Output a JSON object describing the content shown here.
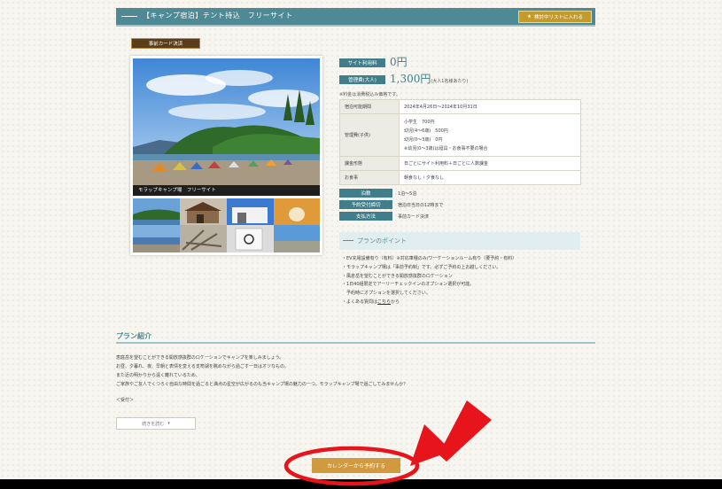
{
  "header": {
    "title": "【キャンプ宿泊】テント持込　フリーサイト",
    "wishlist_label": "検討中リストに入れる"
  },
  "badge": {
    "prepay": "事前カード決済"
  },
  "photo": {
    "caption": "モラップキャンプ場　フリーサイト"
  },
  "pricing": {
    "site_fee_label": "サイト利用料",
    "site_fee_value": "0円",
    "mgmt_fee_label": "管理費(大人)",
    "mgmt_fee_value": "1,300円",
    "mgmt_fee_unit": "(大人1名様あたり)",
    "tax_note": "※料金は消費税込み価格です。"
  },
  "info_table": {
    "period_label": "宿泊可能期間",
    "period_value": "2024年4月26日〜2024年10月31日",
    "child_label": "管理費(子供)",
    "child_values": [
      "小学生　700円",
      "幼児(4〜6歳)　500円",
      "幼児(0〜3歳)　0円",
      "※幼児(0〜3歳)は寝具・お食事不要の場合"
    ],
    "unit_label": "課金形態",
    "unit_value": "日ごとにサイト利用料＋日ごとに人数課金",
    "meal_label": "お食事",
    "meal_value": "朝食なし・夕食なし"
  },
  "details": {
    "nights_label": "泊数",
    "nights_value": "1泊〜5泊",
    "deadline_label": "予約受付締切",
    "deadline_value": "宿泊日当日の12時まで",
    "payment_label": "支払方法",
    "payment_value": "事前カード決済"
  },
  "plan_points": {
    "title": "プランのポイント",
    "items": [
      "・EV充電設備有り（有料）※対応車種のみ/ワーケーションルーム有り（要予約・有料）",
      "・モラップキャンプ場は「事前予約制」です。必ずご予約の上お越しください。",
      "・風倉岳を望むことができる開放感抜群のロケーション",
      "・1日40組限定でアーリーチェックインのオプション選択が可能。",
      "　予約時にオプションを選択してください。"
    ],
    "faq_prefix": "・よくある質問は",
    "faq_link": "こちら",
    "faq_suffix": "から"
  },
  "intro": {
    "title": "プラン紹介",
    "lines": [
      "恵庭岳を望むことができる開放感抜群のロケーションでキャンプを楽しみましょう。",
      "お昼、夕暮れ、夜、早朝と表情を変える支笏湖を眺めながら過ごす一日はオツなもの。",
      "また近の明かりから遠く離れているため、",
      "ご家族やご友人でくつろぐ自由な時間を過ごると満点の星空が広がるのも当キャンプ場の魅力の一つ。モラップキャンプ場で過ごしてみませんか？"
    ],
    "reception": "＜受付＞",
    "more_label": "続きを読む"
  },
  "reserve": {
    "label": "カレンダーから予約する"
  },
  "colors": {
    "teal": "#4d8a96",
    "gold": "#c49a2a",
    "orange": "#d29a3e",
    "annotation": "#e8141c"
  }
}
